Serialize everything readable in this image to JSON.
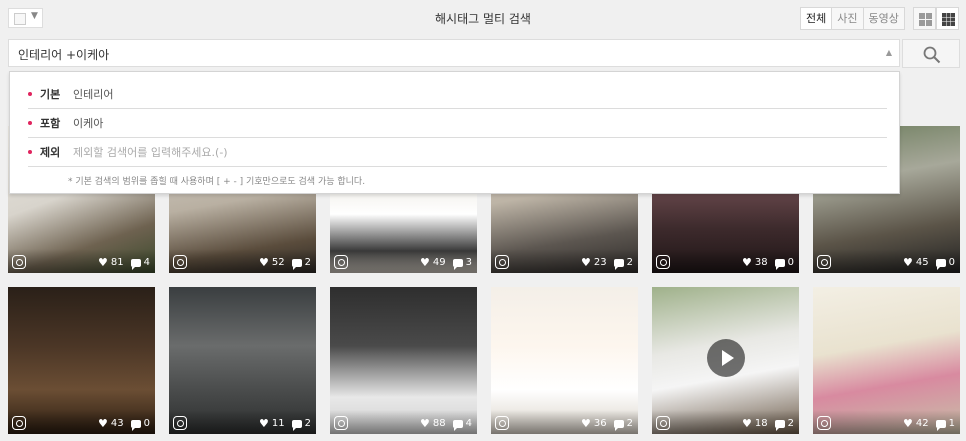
{
  "header": {
    "title": "해시태그 멀티 검색",
    "tabs": [
      "전체",
      "사진",
      "동영상"
    ],
    "view_buttons": [
      "grid-large-icon",
      "grid-small-icon"
    ]
  },
  "search": {
    "query": "인테리어 +이케아",
    "button_icon": "search-icon"
  },
  "filters": {
    "rows": [
      {
        "label": "기본",
        "value": "인테리어",
        "placeholder": ""
      },
      {
        "label": "포함",
        "value": "이케아",
        "placeholder": ""
      },
      {
        "label": "제외",
        "value": "",
        "placeholder": "제외할 검색어를 입력해주세요.(-)"
      }
    ],
    "note": "* 기본 검색의 범위를 좁힐 때 사용하며 [ + - ] 기호만으로도 검색 가능 합니다."
  },
  "colors": {
    "accent_dot": "#e0245e"
  },
  "posts": [
    {
      "likes": "81",
      "comments": "4"
    },
    {
      "likes": "52",
      "comments": "2"
    },
    {
      "likes": "49",
      "comments": "3"
    },
    {
      "likes": "23",
      "comments": "2"
    },
    {
      "likes": "38",
      "comments": "0"
    },
    {
      "likes": "45",
      "comments": "0"
    },
    {
      "likes": "43",
      "comments": "0"
    },
    {
      "likes": "11",
      "comments": "2"
    },
    {
      "likes": "88",
      "comments": "4"
    },
    {
      "likes": "36",
      "comments": "2"
    },
    {
      "likes": "18",
      "comments": "2"
    },
    {
      "likes": "42",
      "comments": "1"
    }
  ]
}
